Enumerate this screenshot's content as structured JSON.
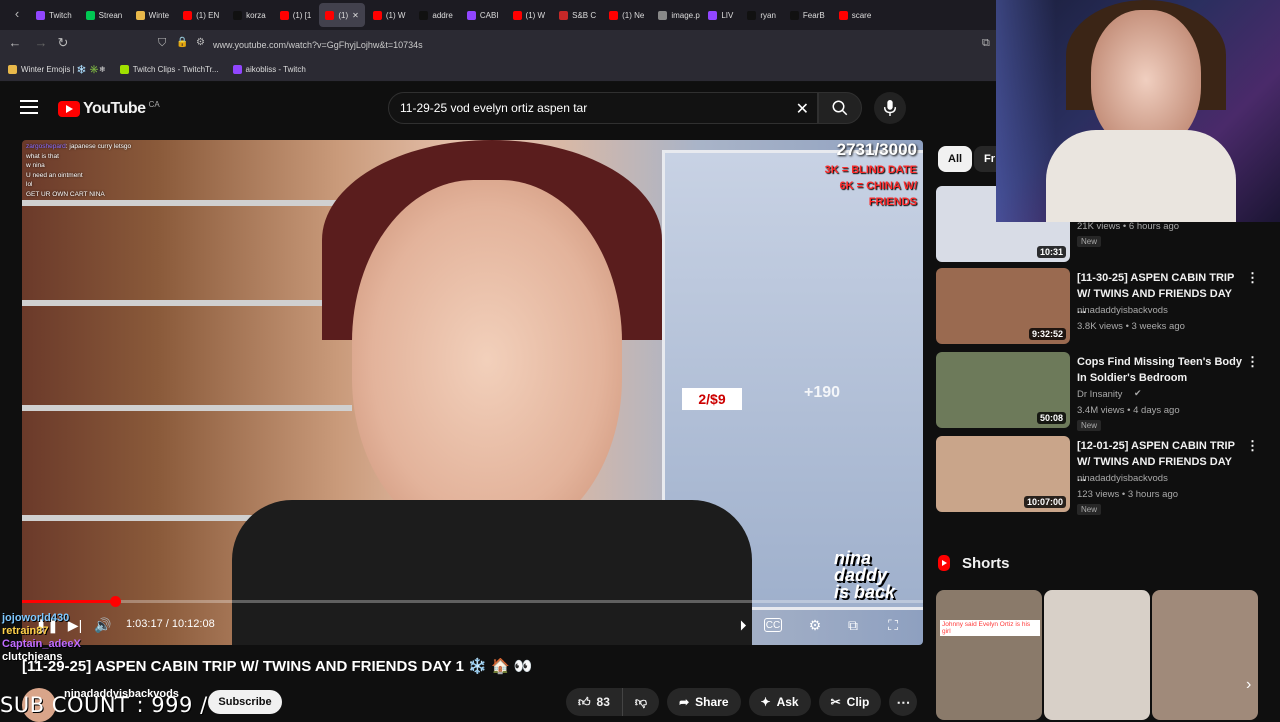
{
  "browser": {
    "tabs": [
      {
        "label": "Twitch",
        "color": "#9146ff"
      },
      {
        "label": "Strean",
        "color": "#00c853"
      },
      {
        "label": "Winte",
        "color": "#e8b84a"
      },
      {
        "label": "(1) EN",
        "color": "#ff0000"
      },
      {
        "label": "korza",
        "color": "#111111"
      },
      {
        "label": "(1) [1",
        "color": "#ff0000"
      },
      {
        "label": "(1)",
        "color": "#ff0000"
      },
      {
        "label": "(1) W",
        "color": "#ff0000"
      },
      {
        "label": "addre",
        "color": "#111111"
      },
      {
        "label": "CABI",
        "color": "#9146ff"
      },
      {
        "label": "(1) W",
        "color": "#ff0000"
      },
      {
        "label": "S&B C",
        "color": "#c62828"
      },
      {
        "label": "(1) Ne",
        "color": "#ff0000"
      },
      {
        "label": "image.png",
        "color": "#888888"
      },
      {
        "label": "LIV",
        "color": "#9146ff"
      },
      {
        "label": "ryan",
        "color": "#111111"
      },
      {
        "label": "FearB",
        "color": "#111111"
      },
      {
        "label": "scare",
        "color": "#ff0000"
      }
    ],
    "active_tab_index": 6,
    "url": "www.youtube.com/watch?v=GgFhyjLojhw&t=10734s",
    "bookmarks": [
      {
        "label": "Winter Emojis | ❄️ ✳️❄",
        "color": "#e8b84a"
      },
      {
        "label": "Twitch Clips - TwitchTr...",
        "color": "#a0e000"
      },
      {
        "label": "aikobliss - Twitch",
        "color": "#9146ff"
      }
    ]
  },
  "header": {
    "logo_text": "YouTube",
    "country": "CA",
    "search_value": "11-29-25 vod evelyn ortiz aspen tar"
  },
  "player": {
    "chat": [
      {
        "user": "zargoshepard",
        "msg": "japanese curry letsgo",
        "color": "#8a6cff"
      },
      {
        "user": "",
        "msg": "what is that",
        "color": "#ffffff"
      },
      {
        "user": "",
        "msg": "w nina",
        "color": "#ffffff"
      },
      {
        "user": "",
        "msg": "U need an ointment",
        "color": "#ffffff"
      },
      {
        "user": "",
        "msg": "lol",
        "color": "#ffffff"
      },
      {
        "user": "",
        "msg": "GET UR OWN CART NINA",
        "color": "#ffffff"
      }
    ],
    "goal": "2731/3000",
    "goal_lines": [
      "3K = BLIND DATE",
      "6K = CHINA W/",
      "FRIENDS"
    ],
    "price_sign": "2/$9",
    "more_badge": "+190",
    "watermark": [
      "nina",
      "daddy",
      "is back"
    ],
    "time_current": "1:03:17",
    "time_total": "10:12:08",
    "progress": 0.1035
  },
  "overlay": {
    "names": [
      "jojoworld430",
      "retrain87",
      "Captain_adeeX",
      "clutchjeans"
    ],
    "sub_count": "SUB COUNT : 999 /"
  },
  "video": {
    "title": "[11-29-25] ASPEN CABIN TRIP W/ TWINS AND FRIENDS DAY 1 ❄️ 🏠 👀",
    "channel": "ninadaddyisbackvods",
    "subscribe": "Subscribe",
    "likes": "83",
    "share": "Share",
    "ask": "Ask",
    "clip": "Clip"
  },
  "sidebar": {
    "chips": [
      "All",
      "Fr"
    ],
    "recs": [
      {
        "title": "",
        "meta": [
          "21K views • 6 hours ago"
        ],
        "duration": "10:31",
        "badge": "New",
        "thumb": "#d8dce6"
      },
      {
        "title": "[11-30-25] ASPEN CABIN TRIP W/ TWINS AND FRIENDS DAY ...",
        "meta": [
          "ninadaddyisbackvods",
          "3.8K views • 3 weeks ago"
        ],
        "duration": "9:32:52",
        "badge": "",
        "thumb": "#9a6a50"
      },
      {
        "title": "Cops Find Missing Teen's Body In Soldier's Bedroom",
        "meta": [
          "Dr Insanity",
          "3.4M views • 4 days ago"
        ],
        "duration": "50:08",
        "badge": "New",
        "thumb": "#6d7a5a"
      },
      {
        "title": "[12-01-25] ASPEN CABIN TRIP W/ TWINS AND FRIENDS DAY ...",
        "meta": [
          "ninadaddyisbackvods",
          "123 views • 3 hours ago"
        ],
        "duration": "10:07:00",
        "badge": "New",
        "thumb": "#c9a58a"
      }
    ],
    "shorts_label": "Shorts",
    "shorts": [
      {
        "caption": "Johnny said Evelyn Ortiz is his girl",
        "color": "#8a7a6a"
      },
      {
        "caption": "",
        "color": "#d8d0c8"
      },
      {
        "caption": "",
        "color": "#a08a7a"
      }
    ]
  },
  "colors": {
    "accent": "#ff0000",
    "bg": "#0f0f0f",
    "pill": "#272727"
  }
}
